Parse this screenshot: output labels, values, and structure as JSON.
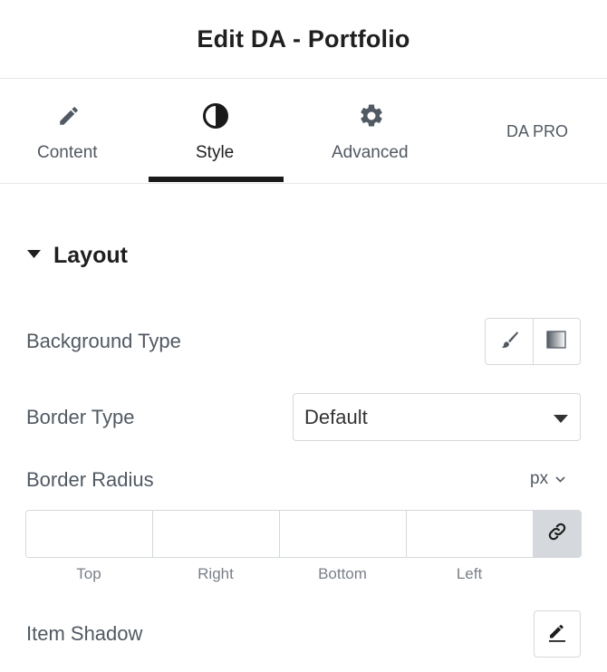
{
  "header": {
    "title": "Edit DA - Portfolio"
  },
  "tabs": [
    {
      "label": "Content",
      "icon": "pencil-icon",
      "active": false
    },
    {
      "label": "Style",
      "icon": "half-circle-contrast-icon",
      "active": true
    },
    {
      "label": "Advanced",
      "icon": "gear-icon",
      "active": false
    },
    {
      "label": "DA PRO",
      "icon": "",
      "active": false
    }
  ],
  "section": {
    "title": "Layout",
    "icon": "caret-down-icon"
  },
  "controls": {
    "background_type": {
      "label": "Background Type",
      "options": [
        {
          "icon": "paint-brush-icon",
          "name": "Classic"
        },
        {
          "icon": "gradient-icon",
          "name": "Gradient"
        }
      ]
    },
    "border_type": {
      "label": "Border Type",
      "value": "Default"
    },
    "border_radius": {
      "label": "Border Radius",
      "unit": "px",
      "fields": [
        {
          "label": "Top",
          "value": ""
        },
        {
          "label": "Right",
          "value": ""
        },
        {
          "label": "Bottom",
          "value": ""
        },
        {
          "label": "Left",
          "value": ""
        }
      ],
      "link_icon": "link-icon"
    },
    "item_shadow": {
      "label": "Item Shadow",
      "icon": "edit-pencil-icon"
    }
  },
  "colors": {
    "text_dark": "#1f1f1f",
    "text_label": "#515962",
    "border": "#d5d8dc",
    "active_indicator": "#1a1a1a"
  }
}
